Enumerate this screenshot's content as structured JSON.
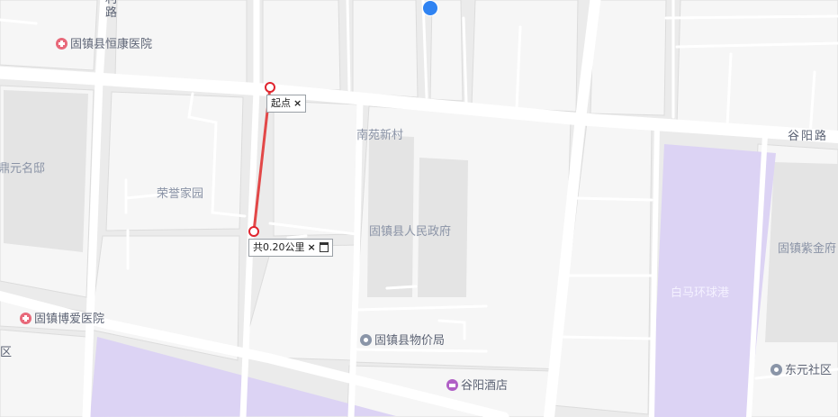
{
  "labels": {
    "hospital_hengkang": "固镇县恒康医院",
    "road_top_1": "利",
    "road_top_2": "路",
    "guyang_road": "谷阳路",
    "nanyuan": "南苑新村",
    "dingyuan": "鼎元名邸",
    "rongyu": "荣誉家园",
    "government": "固镇县人民政府",
    "zijin": "固镇紫金府",
    "baima": "白马环球港",
    "hospital_boai": "固镇博爱医院",
    "district_left": "区",
    "price_bureau": "固镇县物价局",
    "dongyuan": "东元社区",
    "hotel": "谷阳酒店"
  },
  "measure": {
    "start_label": "起点",
    "total_label": "共0.20公里",
    "close_symbol": "×"
  },
  "colors": {
    "block": "#f7f7f7",
    "road": "#ffffff",
    "purple_area": "#dcd3f4",
    "route_line": "#e24848",
    "marker": "#e0242e",
    "location_dot": "#2f83f2"
  }
}
